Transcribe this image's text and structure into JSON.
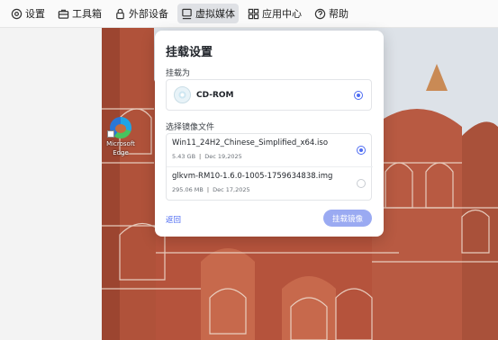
{
  "toolbar": {
    "items": [
      {
        "label": "设置",
        "icon": "gear-icon"
      },
      {
        "label": "工具箱",
        "icon": "toolbox-icon"
      },
      {
        "label": "外部设备",
        "icon": "lock-icon"
      },
      {
        "label": "虚拟媒体",
        "icon": "monitor-icon",
        "active": true
      },
      {
        "label": "应用中心",
        "icon": "apps-grid-icon"
      },
      {
        "label": "帮助",
        "icon": "help-circle-icon"
      }
    ]
  },
  "desktop": {
    "icon_label_line1": "Microsoft",
    "icon_label_line2": "Edge"
  },
  "dialog": {
    "title": "挂载设置",
    "mount_as_label": "挂载为",
    "mount_option": {
      "label": "CD-ROM",
      "selected": true
    },
    "select_file_label": "选择镜像文件",
    "files": [
      {
        "name": "Win11_24H2_Chinese_Simplified_x64.iso",
        "size": "5.43 GB",
        "date": "Dec 19,2025",
        "selected": true
      },
      {
        "name": "glkvm-RM10-1.6.0-1005-1759634838.img",
        "size": "295.06 MB",
        "date": "Dec 17,2025",
        "selected": false
      }
    ],
    "back_label": "返回",
    "mount_button_label": "挂载镜像",
    "separator": "|"
  },
  "colors": {
    "accent": "#4e6cf2",
    "mount_button": "#9aaaf2",
    "building": "#b5533c"
  }
}
